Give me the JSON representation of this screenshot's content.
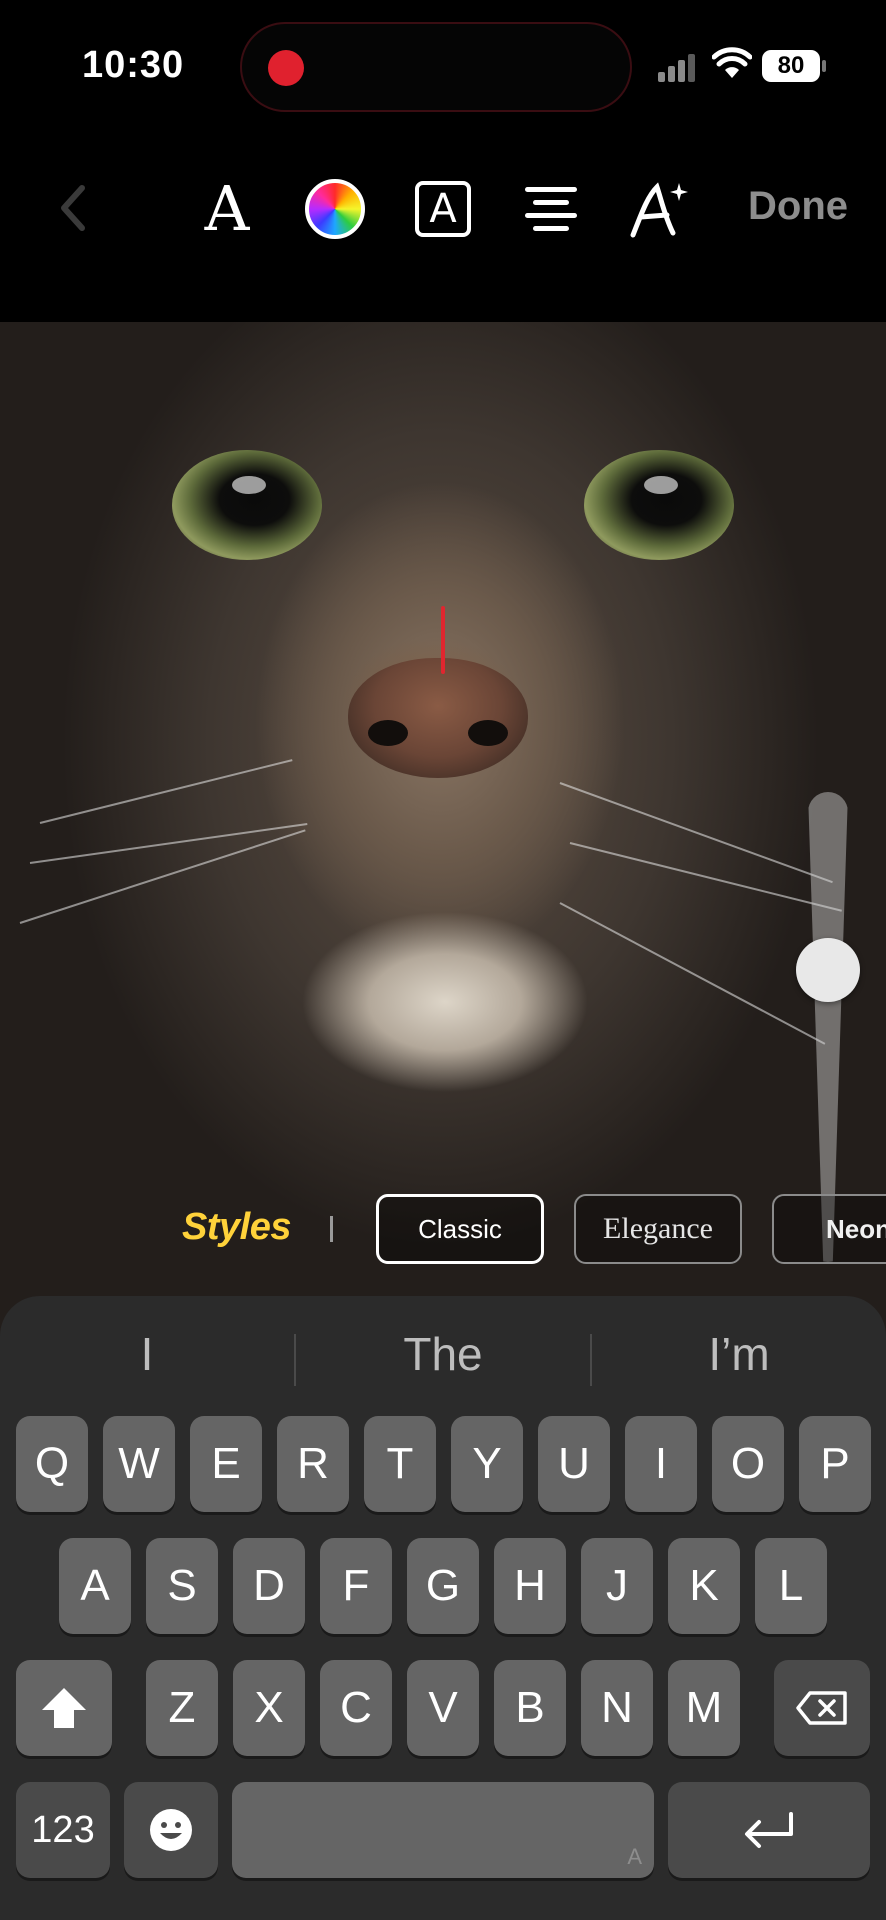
{
  "status_bar": {
    "time": "10:30",
    "battery": "80"
  },
  "toolbar": {
    "font_glyph": "A",
    "box_text_glyph": "A",
    "done_label": "Done",
    "colors": {
      "done": "#8d8d8d",
      "accent": "#ffd23a"
    }
  },
  "styles": {
    "label": "Styles",
    "chips": [
      {
        "label": "Classic",
        "selected": true
      },
      {
        "label": "Elegance",
        "selected": false
      },
      {
        "label": "Neon",
        "selected": false
      }
    ]
  },
  "text_size_slider": {
    "level": 0.64
  },
  "keyboard": {
    "suggestions": [
      "I",
      "The",
      "I’m"
    ],
    "row1": [
      "Q",
      "W",
      "E",
      "R",
      "T",
      "Y",
      "U",
      "I",
      "O",
      "P"
    ],
    "row2": [
      "A",
      "S",
      "D",
      "F",
      "G",
      "H",
      "J",
      "K",
      "L"
    ],
    "row3": [
      "Z",
      "X",
      "C",
      "V",
      "B",
      "N",
      "M"
    ],
    "numbers_key": "123",
    "space_hint": "A"
  }
}
